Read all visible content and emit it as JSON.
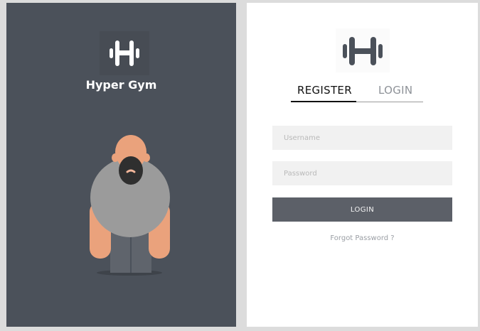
{
  "brand": {
    "name": "Hyper Gym",
    "logo_icon": "dumbbell-h-icon"
  },
  "auth": {
    "tabs": [
      {
        "label": "REGISTER",
        "active": true
      },
      {
        "label": "LOGIN",
        "active": false
      }
    ],
    "username": {
      "placeholder": "Username",
      "value": ""
    },
    "password": {
      "placeholder": "Password",
      "value": ""
    },
    "submit_label": "LOGIN",
    "forgot_label": "Forgot Password ?"
  },
  "colors": {
    "left_panel": "#4b515a",
    "button": "#5c6068",
    "input_bg": "#f1f1f1",
    "page_bg": "#dcdcdc"
  }
}
